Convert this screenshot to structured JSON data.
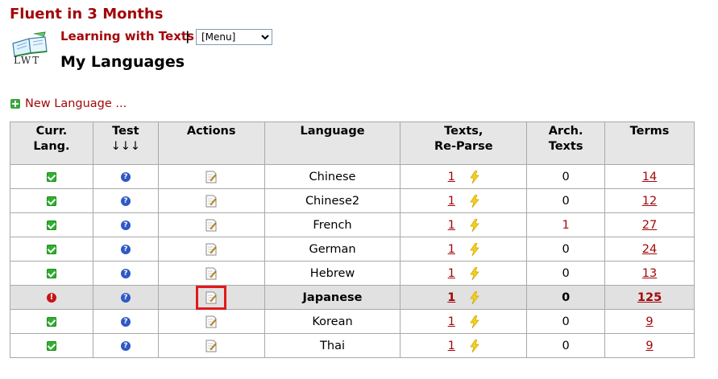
{
  "header": {
    "site_title": "Fluent in 3 Months",
    "logo_text": "LWT",
    "app_link": "Learning with Texts",
    "separator": "|",
    "menu_selected": "[Menu]",
    "page_title": "My Languages"
  },
  "actions": {
    "new_language": "New Language ..."
  },
  "table": {
    "headers": {
      "curr_lang_1": "Curr.",
      "curr_lang_2": "Lang.",
      "test": "Test",
      "test_arrows": "↓↓↓",
      "actions": "Actions",
      "language": "Language",
      "texts_1": "Texts,",
      "texts_2": "Re-Parse",
      "arch_1": "Arch.",
      "arch_2": "Texts",
      "terms": "Terms"
    },
    "rows": [
      {
        "language": "Chinese",
        "texts": "1",
        "arch": "0",
        "terms": "14"
      },
      {
        "language": "Chinese2",
        "texts": "1",
        "arch": "0",
        "terms": "12"
      },
      {
        "language": "French",
        "texts": "1",
        "arch": "1",
        "terms": "27"
      },
      {
        "language": "German",
        "texts": "1",
        "arch": "0",
        "terms": "24"
      },
      {
        "language": "Hebrew",
        "texts": "1",
        "arch": "0",
        "terms": "13"
      },
      {
        "language": "Japanese",
        "texts": "1",
        "arch": "0",
        "terms": "125"
      },
      {
        "language": "Korean",
        "texts": "1",
        "arch": "0",
        "terms": "9"
      },
      {
        "language": "Thai",
        "texts": "1",
        "arch": "0",
        "terms": "9"
      }
    ]
  },
  "colors": {
    "brand_red": "#a3070a",
    "highlight_red": "#e3191c",
    "header_bg": "#e6e6e6",
    "current_row_bg": "#e1e1e1"
  },
  "icons": {
    "set_current": "check-icon",
    "is_current": "alert-icon",
    "test": "help-icon",
    "edit": "edit-icon",
    "reparse": "bolt-icon"
  }
}
